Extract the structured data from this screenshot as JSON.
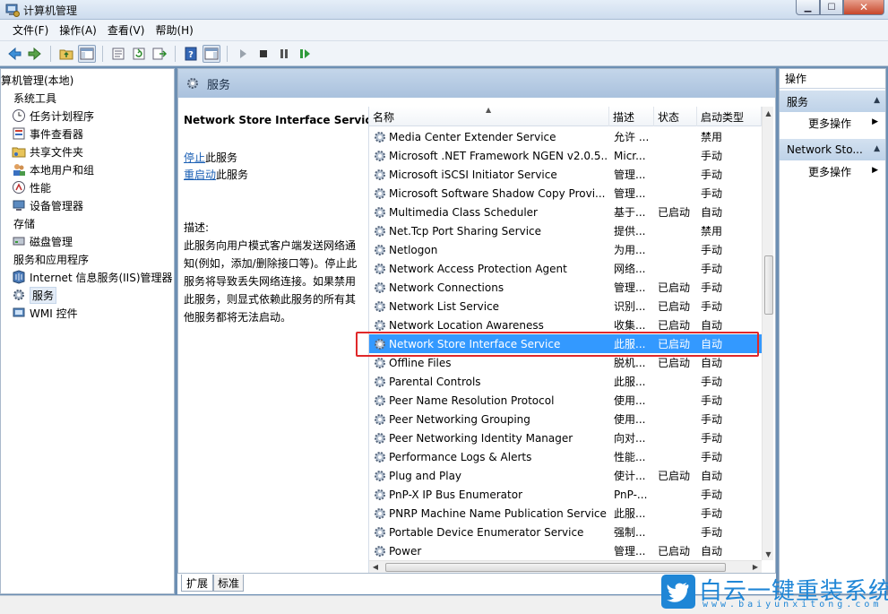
{
  "window": {
    "title": "计算机管理"
  },
  "menu": {
    "items": [
      "文件(F)",
      "操作(A)",
      "查看(V)",
      "帮助(H)"
    ]
  },
  "tree": {
    "items": [
      {
        "label": "算机管理(本地)",
        "icon": "computer-icon"
      },
      {
        "label": "系统工具",
        "icon": "tools-icon"
      },
      {
        "label": "任务计划程序",
        "icon": "clock-icon"
      },
      {
        "label": "事件查看器",
        "icon": "event-viewer-icon"
      },
      {
        "label": "共享文件夹",
        "icon": "shared-folder-icon"
      },
      {
        "label": "本地用户和组",
        "icon": "users-icon"
      },
      {
        "label": "性能",
        "icon": "performance-icon"
      },
      {
        "label": "设备管理器",
        "icon": "device-manager-icon"
      },
      {
        "label": "存储",
        "icon": "storage-icon"
      },
      {
        "label": "磁盘管理",
        "icon": "disk-icon"
      },
      {
        "label": "服务和应用程序",
        "icon": "services-apps-icon"
      },
      {
        "label": "Internet 信息服务(IIS)管理器",
        "icon": "iis-icon"
      },
      {
        "label": "服务",
        "icon": "gear-icon"
      },
      {
        "label": "WMI 控件",
        "icon": "wmi-icon"
      }
    ]
  },
  "middle": {
    "header": "服务",
    "extended": {
      "title": "Network Store Interface Service",
      "stop_link": "停止",
      "stop_suffix": "此服务",
      "restart_link": "重启动",
      "restart_suffix": "此服务",
      "desc_label": "描述:",
      "description": "此服务向用户模式客户端发送网络通知(例如，添加/删除接口等)。停止此服务将导致丢失网络连接。如果禁用此服务，则显式依赖此服务的所有其他服务都将无法启动。"
    },
    "columns": [
      "名称",
      "描述",
      "状态",
      "启动类型"
    ],
    "rows": [
      {
        "name": "Media Center Extender Service",
        "desc": "允许 ...",
        "status": "",
        "startup": "禁用"
      },
      {
        "name": "Microsoft .NET Framework NGEN v2.0.5...",
        "desc": "Micr...",
        "status": "",
        "startup": "手动"
      },
      {
        "name": "Microsoft iSCSI Initiator Service",
        "desc": "管理...",
        "status": "",
        "startup": "手动"
      },
      {
        "name": "Microsoft Software Shadow Copy Provi...",
        "desc": "管理...",
        "status": "",
        "startup": "手动"
      },
      {
        "name": "Multimedia Class Scheduler",
        "desc": "基于...",
        "status": "已启动",
        "startup": "自动"
      },
      {
        "name": "Net.Tcp Port Sharing Service",
        "desc": "提供...",
        "status": "",
        "startup": "禁用"
      },
      {
        "name": "Netlogon",
        "desc": "为用...",
        "status": "",
        "startup": "手动"
      },
      {
        "name": "Network Access Protection Agent",
        "desc": "网络...",
        "status": "",
        "startup": "手动"
      },
      {
        "name": "Network Connections",
        "desc": "管理...",
        "status": "已启动",
        "startup": "手动"
      },
      {
        "name": "Network List Service",
        "desc": "识别...",
        "status": "已启动",
        "startup": "手动"
      },
      {
        "name": "Network Location Awareness",
        "desc": "收集...",
        "status": "已启动",
        "startup": "自动"
      },
      {
        "name": "Network Store Interface Service",
        "desc": "此服...",
        "status": "已启动",
        "startup": "自动",
        "selected": true
      },
      {
        "name": "Offline Files",
        "desc": "脱机...",
        "status": "已启动",
        "startup": "自动"
      },
      {
        "name": "Parental Controls",
        "desc": "此服...",
        "status": "",
        "startup": "手动"
      },
      {
        "name": "Peer Name Resolution Protocol",
        "desc": "使用...",
        "status": "",
        "startup": "手动"
      },
      {
        "name": "Peer Networking Grouping",
        "desc": "使用...",
        "status": "",
        "startup": "手动"
      },
      {
        "name": "Peer Networking Identity Manager",
        "desc": "向对...",
        "status": "",
        "startup": "手动"
      },
      {
        "name": "Performance Logs & Alerts",
        "desc": "性能...",
        "status": "",
        "startup": "手动"
      },
      {
        "name": "Plug and Play",
        "desc": "使计...",
        "status": "已启动",
        "startup": "自动"
      },
      {
        "name": "PnP-X IP Bus Enumerator",
        "desc": "PnP-...",
        "status": "",
        "startup": "手动"
      },
      {
        "name": "PNRP Machine Name Publication Service",
        "desc": "此服...",
        "status": "",
        "startup": "手动"
      },
      {
        "name": "Portable Device Enumerator Service",
        "desc": "强制...",
        "status": "",
        "startup": "手动"
      },
      {
        "name": "Power",
        "desc": "管理...",
        "status": "已启动",
        "startup": "自动"
      }
    ]
  },
  "tabs": [
    "扩展",
    "标准"
  ],
  "actions": {
    "title": "操作",
    "section1": "服务",
    "section1_item": "更多操作",
    "section2": "Network Sto...",
    "section2_item": "更多操作"
  },
  "watermark": {
    "brand": "白云一键重装系统",
    "site": "www.baiyunxitong.com"
  },
  "colors": {
    "selection": "#3399ff",
    "highlight_box": "#e0282a"
  }
}
